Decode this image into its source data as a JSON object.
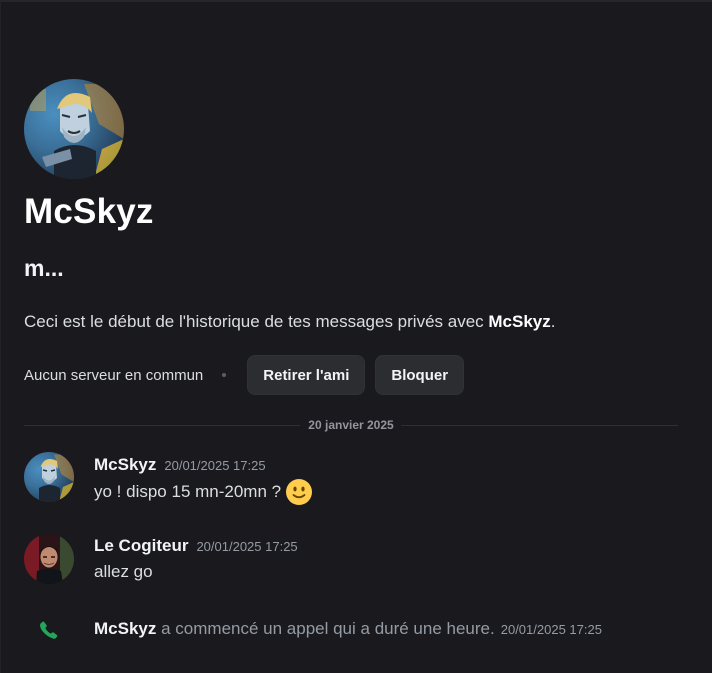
{
  "profile": {
    "name": "McSkyz",
    "status": "m...",
    "intro_prefix": "Ceci est le début de l'historique de tes messages privés avec ",
    "intro_name": "McSkyz",
    "intro_suffix": "."
  },
  "actions": {
    "no_server": "Aucun serveur en commun",
    "remove_friend": "Retirer l'ami",
    "block": "Bloquer"
  },
  "divider": {
    "date": "20 janvier 2025"
  },
  "messages": [
    {
      "author": "McSkyz",
      "timestamp": "20/01/2025 17:25",
      "text": "yo ! dispo 15 mn-20mn ?",
      "emoji": "slightly-smiling-face-icon"
    },
    {
      "author": "Le Cogiteur",
      "timestamp": "20/01/2025 17:25",
      "text": "allez go"
    }
  ],
  "call": {
    "icon": "phone-icon",
    "author": "McSkyz",
    "text": "a commencé un appel qui a duré une heure.",
    "timestamp": "20/01/2025 17:25"
  },
  "colors": {
    "background": "#1a1a1e",
    "button_bg": "#2b2d31",
    "call_green": "#23a55a",
    "muted_text": "#949ba4"
  }
}
